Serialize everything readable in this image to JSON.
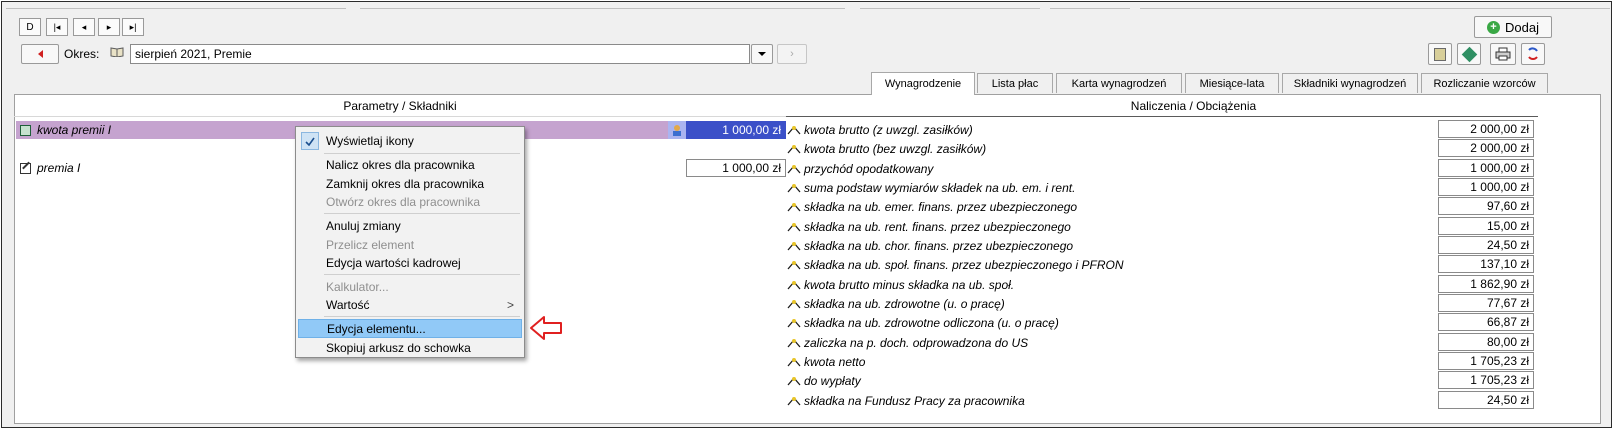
{
  "toolbar": {
    "nav": [
      "D",
      "|◂",
      "◂",
      "▸",
      "▸|"
    ],
    "add_label": "Dodaj"
  },
  "period": {
    "label": "Okres:",
    "value": "sierpień 2021, Premie"
  },
  "tabs": [
    {
      "label": "Wynagrodzenie",
      "active": true
    },
    {
      "label": "Lista płac",
      "active": false
    },
    {
      "label": "Karta wynagrodzeń",
      "active": false
    },
    {
      "label": "Miesiące-lata",
      "active": false
    },
    {
      "label": "Składniki wynagrodzeń",
      "active": false
    },
    {
      "label": "Rozliczanie wzorców",
      "active": false
    }
  ],
  "left_panel": {
    "header": "Parametry / Składniki",
    "rows": [
      {
        "label": "kwota premii I",
        "value": "1 000,00 zł",
        "selected": true
      },
      {
        "label": "premia I",
        "value": "1 000,00 zł",
        "selected": false
      }
    ]
  },
  "right_panel": {
    "header": "Naliczenia / Obciążenia",
    "rows": [
      {
        "label": "kwota brutto (z uwzgl. zasiłków)",
        "value": "2 000,00 zł"
      },
      {
        "label": "kwota brutto (bez uwzgl. zasiłków)",
        "value": "2 000,00 zł"
      },
      {
        "label": "przychód opodatkowany",
        "value": "1 000,00 zł"
      },
      {
        "label": "suma podstaw wymiarów składek na ub. em. i rent.",
        "value": "1 000,00 zł"
      },
      {
        "label": "składka na ub. emer. finans. przez ubezpieczonego",
        "value": "97,60 zł"
      },
      {
        "label": "składka na ub. rent. finans. przez ubezpieczonego",
        "value": "15,00 zł"
      },
      {
        "label": "składka na ub. chor. finans. przez ubezpieczonego",
        "value": "24,50 zł"
      },
      {
        "label": "składka na ub. społ. finans. przez ubezpieczonego i PFRON",
        "value": "137,10 zł"
      },
      {
        "label": "kwota brutto minus składka na ub. społ.",
        "value": "1 862,90 zł"
      },
      {
        "label": "składka na ub. zdrowotne (u. o pracę)",
        "value": "77,67 zł"
      },
      {
        "label": "składka na ub. zdrowotne odliczona (u. o pracę)",
        "value": "66,87 zł"
      },
      {
        "label": "zaliczka na p. doch. odprowadzona do US",
        "value": "80,00 zł"
      },
      {
        "label": "kwota netto",
        "value": "1 705,23 zł"
      },
      {
        "label": "do wypłaty",
        "value": "1 705,23 zł"
      },
      {
        "label": "składka na Fundusz Pracy za pracownika",
        "value": "24,50 zł"
      }
    ]
  },
  "context_menu": {
    "items": [
      {
        "label": "Wyświetlaj ikony",
        "checked": true,
        "disabled": false
      },
      {
        "label": "Nalicz okres dla pracownika",
        "disabled": false
      },
      {
        "label": "Zamknij okres dla pracownika",
        "disabled": false
      },
      {
        "label": "Otwórz okres dla pracownika",
        "disabled": true
      },
      {
        "label": "Anuluj zmiany",
        "disabled": false
      },
      {
        "label": "Przelicz element",
        "disabled": true
      },
      {
        "label": "Edycja wartości kadrowej",
        "disabled": false
      },
      {
        "label": "Kalkulator...",
        "disabled": true
      },
      {
        "label": "Wartość",
        "disabled": false,
        "submenu": ">"
      },
      {
        "label": "Edycja elementu...",
        "disabled": false,
        "highlighted": true
      },
      {
        "label": "Skopiuj arkusz do schowka",
        "disabled": false
      }
    ]
  },
  "colors": {
    "selected_row": "#c5a3cf",
    "selected_value": "#3b50c8",
    "menu_highlight": "#91c9f7",
    "arrow": "#e02020",
    "add_icon": "#3aa845"
  }
}
